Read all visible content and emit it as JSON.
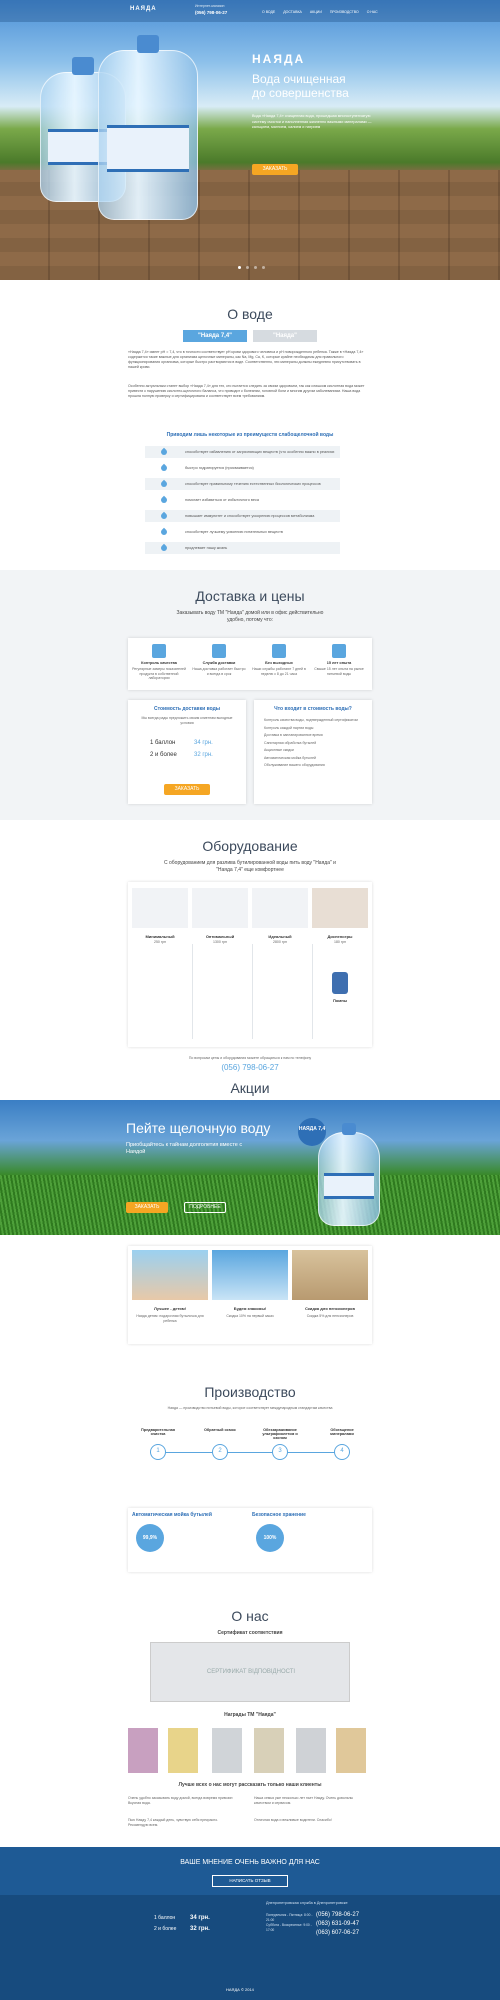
{
  "header": {
    "brand": "НАЯДА",
    "phone_label": "Интернет-магазин",
    "phone": "(056) 798-06-27",
    "menu": [
      "О ВОДЕ",
      "ДОСТАВКА",
      "АКЦИИ",
      "ПРОИЗВОДСТВО",
      "О НАС"
    ]
  },
  "hero": {
    "brand": "НАЯДА",
    "headline1": "Вода очищенная",
    "headline2": "до совершенства",
    "text": "Вода «Наяда 7,4» очищенная вода, прошедшая многоступенчатую систему очистки и наполненная жизненно важными минералами — кальцием, магнием, калием и натрием",
    "btn": "ЗАКАЗАТЬ"
  },
  "about": {
    "title": "О воде",
    "tab1": "\"Наяда 7,4\"",
    "tab2": "\"Наяда\"",
    "p1": "«Наяда 7,4» имеет pH = 7,4, что в точности соответствует pH крови здорового человека и pH новорожденного ребенка. Также в «Наяда 7,4» содержится такие важные для организма щелочные минералы, как Na, Mg, Ca, K, которые крайне необходимы для правильного функционирования организма, которые быстро растворяются в воде. Соответственно, эти минералы должны ежедневно присутствовать в нашей крови.",
    "p2": "Особенно актуальным станет выбор «Наяда 7,4» для тех, кто пытается следить за своим здоровьем, так как слишком кислотная вода может привести к нарушению кислотно-щелочного баланса, что приводит к болезням, головной боли и многим другим заболеваниям. Наша вода прошла полную проверку и сертифицирована и соответствует всем требованиям.",
    "sub": "Приводим лишь некоторые из преимуществ слабощелочной воды",
    "items": [
      "способствует избавлению от загрязняющих веществ (что особенно важно в реалиях нашего региона)",
      "быстро гидратируется (присваивается)",
      "способствует правильному течению естественных биологических процессов",
      "помогает избавиться от избыточного веса",
      "повышает иммунитет и способствует ускорению процессов метаболизма",
      "способствует лучшему усвоению питательных веществ",
      "продлевает нашу жизнь"
    ]
  },
  "delivery": {
    "title": "Доставка и цены",
    "intro": "Заказывать воду ТМ \"Наяда\" домой или в офис действительно удобно, потому что:",
    "features": [
      {
        "t": "Контроль качества",
        "d": "Регулярные замеры показателей продукта в собственной лаборатории"
      },
      {
        "t": "Служба доставки",
        "d": "Наша доставка работает быстро и всегда в срок"
      },
      {
        "t": "Без выходных",
        "d": "Наши службы работают 7 дней в неделю с 8 до 21 часа"
      },
      {
        "t": "15 лет опыта",
        "d": "Свыше 15 лет опыта на рынке питьевой воды"
      }
    ],
    "cost_title": "Стоимость доставки воды",
    "cost_note": "Мы всегда рады предложить своим клиентам выгодные условия",
    "p1_label": "1 баллон",
    "p1": "34 грн.",
    "p2_label": "2 и более",
    "p2": "32 грн.",
    "btn": "ЗАКАЗАТЬ",
    "incl_title": "Что входит в стоимость воды?",
    "incl": [
      "Контроль качества воды, подтвержденный сертификатом",
      "Контроль каждой партии воды",
      "Доставка в запланированное время",
      "Санитарная обработка бутылей",
      "Акционные скидки",
      "Автоматическая мойка бутылей",
      "Обслуживание вашего оборудования"
    ]
  },
  "equipment": {
    "title": "Оборудование",
    "intro": "С оборудованием для разлива бутилированной воды пить воду \"Наяда\" и \"Наяда 7,4\" еще комфортнее",
    "items": [
      {
        "n": "Минимальный",
        "p": "250 грн"
      },
      {
        "n": "Оптимальный",
        "p": "1300 грн"
      },
      {
        "n": "Идеальный",
        "p": "2800 грн"
      },
      {
        "n": "Диспенсеры",
        "p": "180 грн"
      }
    ],
    "pumps": "Помпы",
    "contact": "По вопросам цены и оборудования можете обращаться к нам по телефону",
    "phone": "(056) 798-06-27"
  },
  "promo": {
    "title": "Акции",
    "headline": "Пейте щелочную воду",
    "sub": "Приобщайтесь к тайнам долголетия вместе с Наядой",
    "btn1": "ЗАКАЗАТЬ",
    "btn2": "ПОДРОБНЕЕ",
    "brand": "НАЯДА 7,4",
    "cards": [
      {
        "t": "Лучшее - детям!",
        "d": "Наяда детям: подарочная бутылочка для ребенка"
      },
      {
        "t": "Будем знакомы!",
        "d": "Скидка 10% на первый заказ"
      },
      {
        "t": "Скидка для пенсионеров",
        "d": "Скидка 5% для пенсионеров"
      }
    ]
  },
  "production": {
    "title": "Производство",
    "intro": "Наяда — производство питьевой воды, которое соответствует международным стандартам качества",
    "steps": [
      {
        "t": "Предварительная очистка"
      },
      {
        "t": "Обратный осмос"
      },
      {
        "t": "Обеззараживание ультрафиолетом и озоном"
      },
      {
        "t": "Обогащение минералами"
      }
    ],
    "wash_title": "Автоматическая мойка бутылей",
    "wash_pct": "99,9%",
    "store_title": "Безопасное хранение",
    "store_pct": "100%"
  },
  "about_us": {
    "title": "О нас",
    "cert_title": "Сертификат соответствия",
    "cert_text": "СЕРТИФИКАТ ВІДПОВІДНОСТІ",
    "awards_title": "Награды ТМ \"Наяда\"",
    "reviews_title": "Лучше всех о нас могут рассказать только наши клиенты",
    "reviews": [
      "Очень удобно заказывать воду домой, всегда вовремя привозят. Вкусная вода.",
      "Наша семья уже несколько лет пьет Наяду. Очень довольны качеством и сервисом.",
      "Пью Наяду 7,4 каждый день, чувствую себя прекрасно. Рекомендую всем.",
      "Отличная вода и вежливые водители. Спасибо!"
    ]
  },
  "footer": {
    "feedback": "ВАШЕ МНЕНИЕ ОЧЕНЬ ВАЖНО ДЛЯ НАС",
    "btn": "НАПИСАТЬ ОТЗЫВ",
    "city": "Днепропетровская служба в Днепропетровске",
    "p1_label": "1 баллон",
    "p1": "34 грн.",
    "p2_label": "2 и более",
    "p2": "32 грн.",
    "phones": [
      "(056) 798-06-27",
      "(063) 631-09-47",
      "(063) 607-06-27"
    ],
    "hours": [
      "Понедельник - Пятница: 8:00 - 21:00",
      "Суббота - Воскресенье: 9:00 - 17:00"
    ],
    "copyright": "2014",
    "logo": "НАЯДА"
  }
}
